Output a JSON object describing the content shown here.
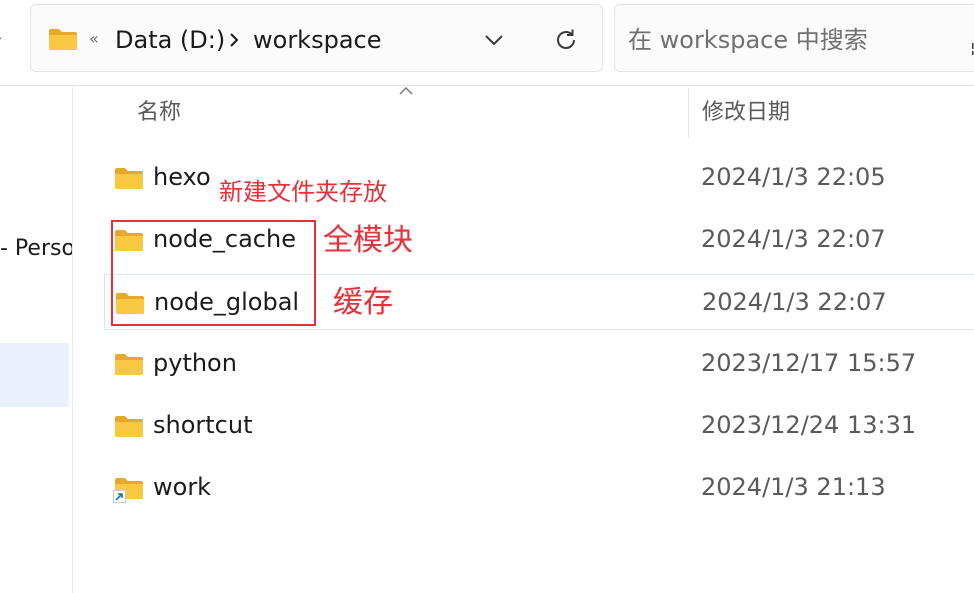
{
  "address_bar": {
    "overflow_glyph": "«",
    "crumbs": [
      "Data (D:)",
      "workspace"
    ]
  },
  "search": {
    "placeholder": "在 workspace 中搜索"
  },
  "nav_pane": {
    "partial_item": "- Perso"
  },
  "columns": {
    "name": "名称",
    "date_modified": "修改日期"
  },
  "files": [
    {
      "name": "hexo",
      "date": "2024/1/3 22:05",
      "icon": "folder-icon"
    },
    {
      "name": "node_cache",
      "date": "2024/1/3 22:07",
      "icon": "folder-icon"
    },
    {
      "name": "node_global",
      "date": "2024/1/3 22:07",
      "icon": "folder-icon"
    },
    {
      "name": "python",
      "date": "2023/12/17 15:57",
      "icon": "folder-icon"
    },
    {
      "name": "shortcut",
      "date": "2023/12/24 13:31",
      "icon": "folder-icon"
    },
    {
      "name": "work",
      "date": "2024/1/3 21:13",
      "icon": "folder-shortcut-icon"
    }
  ],
  "annotations": {
    "note_1": "新建文件夹存放",
    "note_2": "全模块",
    "note_3": "缓存",
    "color": "#e8303a"
  },
  "colors": {
    "folder_yellow": "#f8c842",
    "folder_tab": "#e6a92a",
    "selection_blue": "#e9f2fc",
    "hover_border": "#d6e8f7"
  }
}
